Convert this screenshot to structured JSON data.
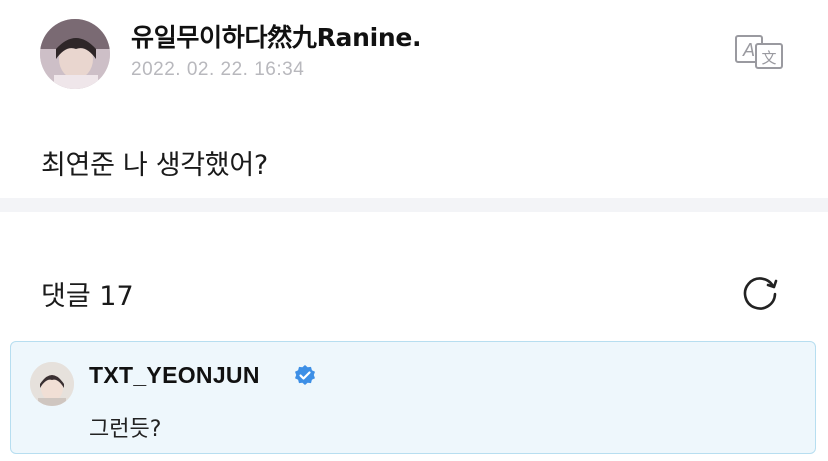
{
  "post": {
    "author": "유일무이하다然九Ranine.",
    "timestamp": "2022. 02. 22. 16:34",
    "body": "최연준 나 생각했어?",
    "avatar_icon": "user-avatar",
    "translate_icon": "translate-icon"
  },
  "comments": {
    "title": "댓글 17",
    "refresh_icon": "refresh-icon",
    "items": [
      {
        "author": "TXT_YEONJUN",
        "verified": true,
        "text": "그런듯?",
        "highlight_color": "#eef7fc"
      }
    ]
  },
  "colors": {
    "verified_badge": "#3d8fe6",
    "timestamp": "#b8b8bd",
    "divider": "#f3f4f7",
    "comment_border": "#b7def0"
  }
}
